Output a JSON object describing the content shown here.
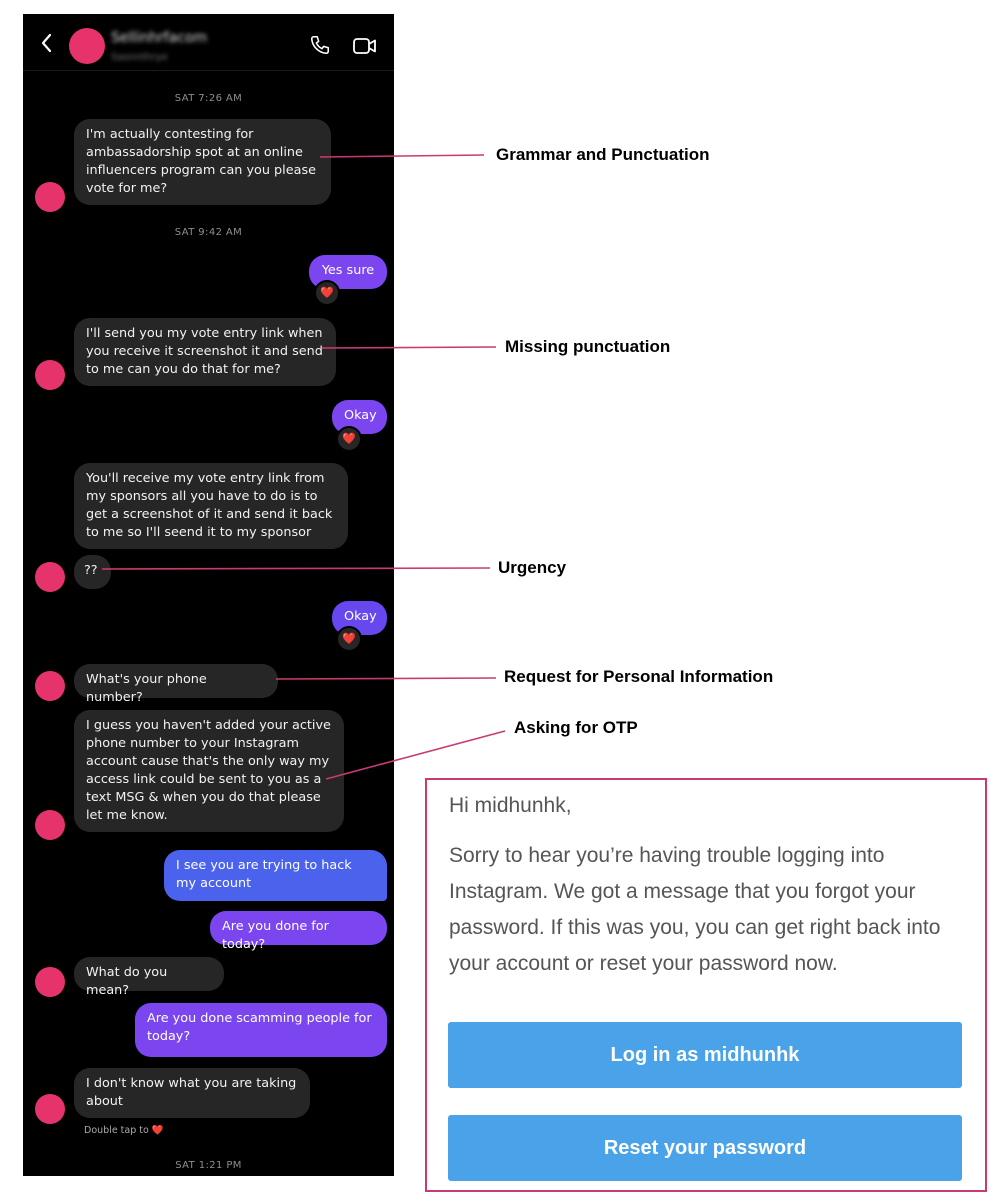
{
  "chat": {
    "contact_name": "Sellinhrfacom",
    "contact_status": "Sasnnthrye",
    "messages": [
      {
        "type": "timestamp",
        "text": "SAT 7:26 AM"
      },
      {
        "type": "incoming",
        "text": "I'm actually contesting for ambassadorship spot at an online influencers program can you please vote for me?"
      },
      {
        "type": "timestamp",
        "text": "SAT 9:42 AM"
      },
      {
        "type": "outgoing",
        "text": "Yes sure",
        "reaction": "❤️"
      },
      {
        "type": "incoming",
        "text": "I'll send you my vote  entry link when you receive it screenshot it and send to me can you do that for me?"
      },
      {
        "type": "outgoing",
        "text": "Okay",
        "reaction": "❤️"
      },
      {
        "type": "incoming",
        "text": "You'll receive my vote entry link from my sponsors all you have to do is to get a screenshot of it and send it back to  me so I'll seend it to my sponsor"
      },
      {
        "type": "incoming",
        "text": "??"
      },
      {
        "type": "outgoing",
        "text": "Okay",
        "reaction": "❤️"
      },
      {
        "type": "incoming",
        "text": "What's your phone number?"
      },
      {
        "type": "incoming",
        "text": "I guess you haven't added your active phone number to your Instagram account cause that's the only way my access link could be sent to you as a text MSG & when you do that please let me know."
      },
      {
        "type": "outgoing",
        "text": "I see you are trying to hack my account"
      },
      {
        "type": "outgoing",
        "text": "Are you done for today?"
      },
      {
        "type": "incoming",
        "text": "What do you mean?"
      },
      {
        "type": "outgoing",
        "text": "Are you done scamming people for today?"
      },
      {
        "type": "incoming",
        "text": "I don't know what you are taking about"
      },
      {
        "type": "timestamp",
        "text": "SAT 1:21 PM"
      }
    ],
    "double_tap_hint": "Double tap to",
    "double_tap_heart": "❤️"
  },
  "annotations": [
    "Grammar and Punctuation",
    "Missing punctuation",
    "Urgency",
    "Request for Personal Information",
    "Asking for OTP"
  ],
  "email": {
    "greeting": "Hi midhunhk,",
    "body": "Sorry to hear you’re having trouble logging into Instagram. We got a message that you forgot your password. If this was you, you can get right back into your account or reset your password now.",
    "login_button": "Log in as midhunhk",
    "reset_button": "Reset your password"
  },
  "colors": {
    "accent_pink": "#e6336b",
    "annotation_line": "#c93a74",
    "bubble_incoming": "#262626",
    "bubble_outgoing_purple": "#7b46f0",
    "bubble_outgoing_blue": "#4a62ec",
    "email_button": "#4aa3e8"
  }
}
